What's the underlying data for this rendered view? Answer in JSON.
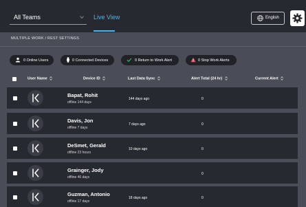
{
  "header": {
    "team_select": "All Teams",
    "live_tab": "Live View",
    "language_button": "English"
  },
  "section_title": "MULTIPLE WORK / REST SETTINGS",
  "summary": [
    {
      "label": "0 Online Users",
      "icon": "user-icon"
    },
    {
      "label": "0 Connected Devices",
      "icon": "watch-icon"
    },
    {
      "label": "0 Return to Work Alert",
      "icon": "check-icon"
    },
    {
      "label": "0 Stop Work Alerts",
      "icon": "warning-icon"
    }
  ],
  "columns": {
    "user_name": "User Name",
    "device_id": "Device ID",
    "last_sync": "Last Data Sync",
    "alert_total": "Alert Total (24 hr)",
    "current_alert": "Current Alert"
  },
  "rows": [
    {
      "name": "Bapat, Rohit",
      "status": "offline 144 days",
      "last_sync": "144 days ago",
      "alert_total": "0"
    },
    {
      "name": "Davis, Jon",
      "status": "offline 7 days",
      "last_sync": "7 days ago",
      "alert_total": "0"
    },
    {
      "name": "DeSmet, Gerald",
      "status": "offline 23 hours",
      "last_sync": "10 days ago",
      "alert_total": "0"
    },
    {
      "name": "Grainger, Jody",
      "status": "offline 46 days",
      "last_sync": "",
      "alert_total": "0"
    },
    {
      "name": "Guzman, Antonio",
      "status": "offline 17 days",
      "last_sync": "18 days ago",
      "alert_total": "0"
    }
  ],
  "colors": {
    "accent": "#48b8ee",
    "topbar": "#272930",
    "background": "#4a4d57",
    "row": "#272930",
    "check": "#39c36a",
    "warning": "#e2504f"
  }
}
